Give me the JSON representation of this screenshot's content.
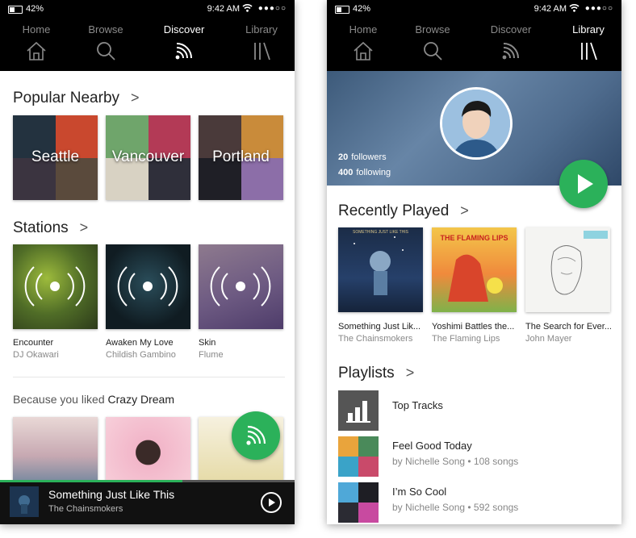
{
  "colors": {
    "accent": "#2bb15a",
    "nav_bg": "#000000"
  },
  "status": {
    "battery": "42%",
    "time": "9:42 AM",
    "signal": "●●●○○"
  },
  "nav": {
    "home": "Home",
    "browse": "Browse",
    "discover": "Discover",
    "library": "Library"
  },
  "discover": {
    "popular_title": "Popular Nearby",
    "cities": [
      "Seattle",
      "Vancouver",
      "Portland"
    ],
    "stations_title": "Stations",
    "stations": [
      {
        "title": "Encounter",
        "artist": "DJ Okawari"
      },
      {
        "title": "Awaken My Love",
        "artist": "Childish Gambino"
      },
      {
        "title": "Skin",
        "artist": "Flume"
      }
    ],
    "because_prefix": "Because you liked",
    "because_album": "Crazy Dream"
  },
  "player": {
    "title": "Something Just Like This",
    "artist": "The Chainsmokers",
    "progress": 0.62
  },
  "profile": {
    "followers_count": "20",
    "followers_label": "followers",
    "following_count": "400",
    "following_label": "following"
  },
  "library": {
    "recent_title": "Recently Played",
    "recent": [
      {
        "title": "Something Just Lik...",
        "artist": "The Chainsmokers",
        "cover_text": "SOMETHING JUST LIKE THIS"
      },
      {
        "title": "Yoshimi Battles the...",
        "artist": "The Flaming Lips",
        "cover_text": "THE FLAMING LIPS"
      },
      {
        "title": "The Search for Ever...",
        "artist": "John Mayer"
      }
    ],
    "playlists_title": "Playlists",
    "playlists": [
      {
        "name": "Top Tracks",
        "meta": ""
      },
      {
        "name": "Feel Good Today",
        "meta": "by Nichelle Song • 108 songs"
      },
      {
        "name": "I’m So Cool",
        "meta": "by Nichelle Song • 592 songs"
      }
    ]
  }
}
